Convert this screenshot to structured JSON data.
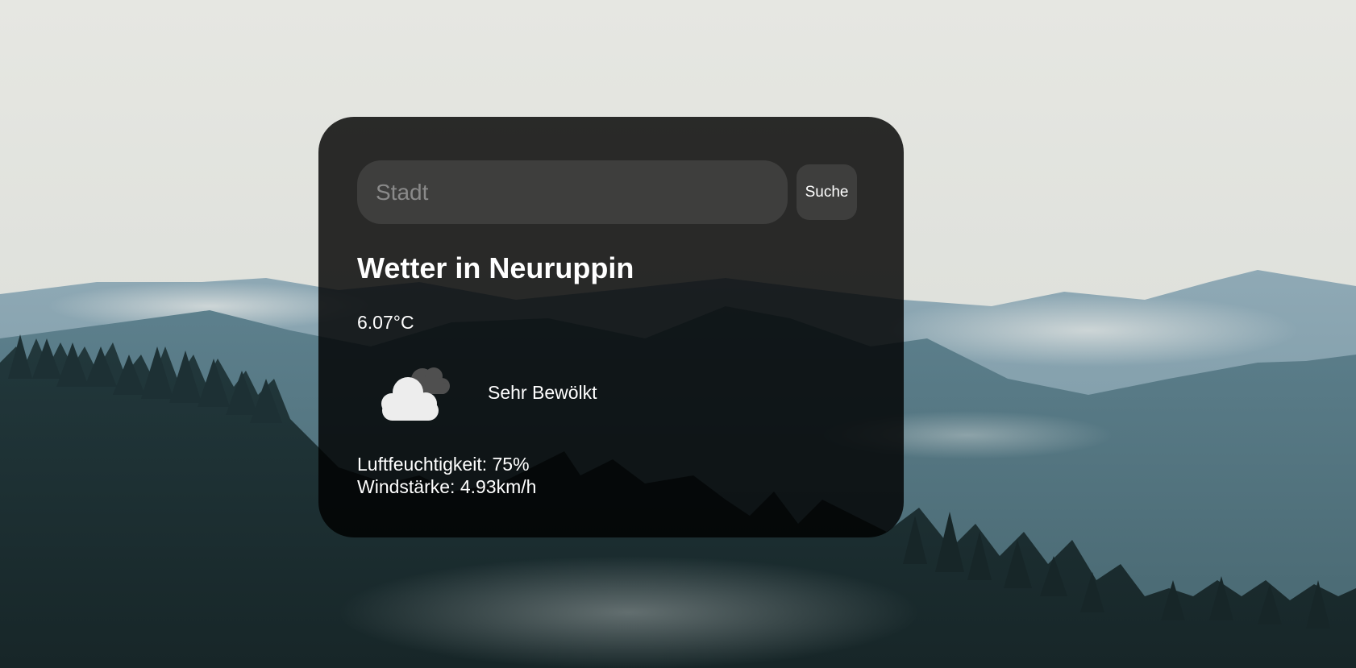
{
  "search": {
    "placeholder": "Stadt",
    "button_label": "Suche"
  },
  "weather": {
    "city_title": "Wetter in Neuruppin",
    "temperature": "6.07°C",
    "description": "Sehr Bewölkt",
    "icon": "broken-clouds-icon",
    "humidity": "Luftfeuchtigkeit: 75%",
    "wind": "Windstärke: 4.93km/h"
  },
  "colors": {
    "card_background": "#000000",
    "text": "#ffffff",
    "input_background": "#3a3a3a",
    "placeholder": "#8a8a8a"
  }
}
